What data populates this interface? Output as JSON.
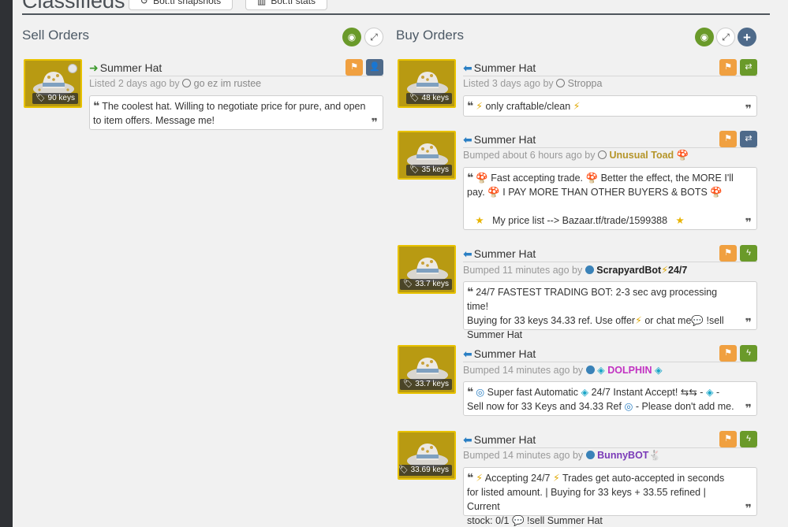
{
  "header": {
    "title": "Classifieds",
    "buttons": [
      {
        "icon": "history-icon",
        "label": "Bot.tf snapshots"
      },
      {
        "icon": "bar-chart-icon",
        "label": "Bot.tf stats"
      }
    ]
  },
  "sell": {
    "title": "Sell Orders",
    "listings": [
      {
        "item": "Summer Hat",
        "price": "90 keys",
        "time": "Listed 2 days ago by",
        "user": "go ez im rustee",
        "text1": "The coolest hat. Willing to negotiate price for pure, and open",
        "text2": "to item offers. Message me!"
      }
    ]
  },
  "buy": {
    "title": "Buy Orders",
    "listings": [
      {
        "item": "Summer Hat",
        "price": "48 keys",
        "time": "Listed 3 days ago by",
        "user": "Stroppa",
        "text1": "only craftable/clean"
      },
      {
        "item": "Summer Hat",
        "price": "35 keys",
        "time": "Bumped about 6 hours ago by",
        "user": "Unusual Toad",
        "text1": "Fast accepting trade.",
        "text2": "Better the effect, the MORE I'll",
        "text3": "pay.",
        "text4": "I PAY MORE THAN OTHER BUYERS & BOTS",
        "text5": "My price list --> Bazaar.tf/trade/1599388"
      },
      {
        "item": "Summer Hat",
        "price": "33.7 keys",
        "time": "Bumped 11 minutes ago by",
        "user": "ScrapyardBot",
        "user_suffix": "24/7",
        "text1": "24/7 FASTEST TRADING BOT: 2-3 sec avg processing time!",
        "text2": "Buying for 33 keys 34.33 ref. Use offer",
        "text3": "or chat me",
        "text4": "!sell",
        "text5": "Summer Hat"
      },
      {
        "item": "Summer Hat",
        "price": "33.7 keys",
        "time": "Bumped 14 minutes ago by",
        "user": "DOLPHIN",
        "text1": "Super fast Automatic",
        "text2": "24/7 Instant Accept!",
        "text3": "-",
        "text4": "-",
        "text5": "Sell now for 33 Keys and 34.33 Ref",
        "text6": "- Please don't add me."
      },
      {
        "item": "Summer Hat",
        "price": "33.69 keys",
        "time": "Bumped 14 minutes ago by",
        "user": "BunnyBOT",
        "text1": "Accepting 24/7",
        "text2": "Trades get auto-accepted in seconds",
        "text3": "for listed amount. | Buying for 33 keys + 33.55 refined | Current",
        "text4": "stock: 0/1",
        "text5": "!sell Summer Hat"
      }
    ]
  }
}
